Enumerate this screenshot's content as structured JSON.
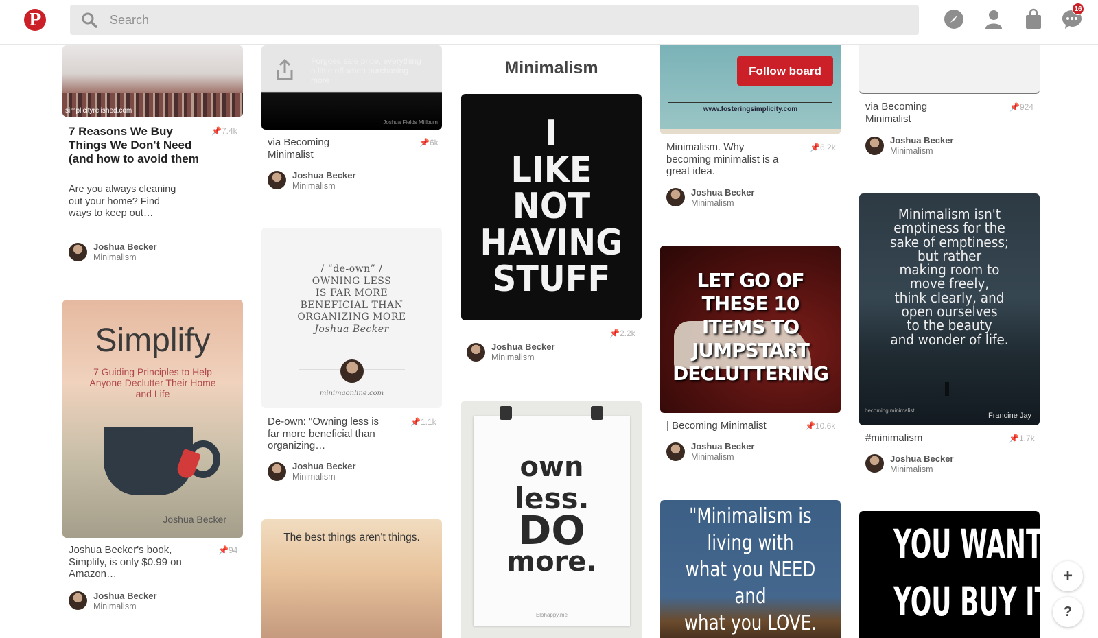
{
  "header": {
    "search_placeholder": "Search",
    "notification_count": "16",
    "brand_color": "#cb2027"
  },
  "board": {
    "title": "Minimalism",
    "follow_label": "Follow board"
  },
  "pins": [
    {
      "id": "p1",
      "title": "7 Reasons We Buy Things We Don't Need (and how to avoid them",
      "desc": "Are you always cleaning out your home? Find ways to keep out…",
      "repins": "7.4k",
      "user": "Joshua Becker",
      "board": "Minimalism",
      "img_caption": "simplicityrelished.com"
    },
    {
      "id": "p2",
      "desc": "via Becoming Minimalist",
      "repins": "6k",
      "user": "Joshua Becker",
      "board": "Minimalism",
      "img_caption": "Joshua Fields Millburn",
      "img_text": "Forgoes sale price, everything a little off when purchasing more"
    },
    {
      "id": "p3",
      "img_lines": [
        "I",
        "LIKE",
        "NOT",
        "HAVING",
        "STUFF"
      ],
      "repins": "2.2k",
      "user": "Joshua Becker",
      "board": "Minimalism"
    },
    {
      "id": "p4",
      "desc": "Minimalism. Why becoming minimalist is a great idea.",
      "repins": "6.2k",
      "user": "Joshua Becker",
      "board": "Minimalism",
      "img_caption": "www.fosteringsimplicity.com"
    },
    {
      "id": "p5",
      "desc": "via Becoming Minimalist",
      "repins": "924",
      "user": "Joshua Becker",
      "board": "Minimalism"
    },
    {
      "id": "p6",
      "img_lines": [
        "/ “de-own” /",
        "OWNING LESS",
        "IS FAR MORE",
        "BENEFICIAL THAN",
        "ORGANIZING MORE",
        "Joshua Becker"
      ],
      "img_caption": "minimaonline.com",
      "desc": "De-own: \"Owning less is far more beneficial than organizing…",
      "repins": "1.1k",
      "user": "Joshua Becker",
      "board": "Minimalism"
    },
    {
      "id": "p7",
      "img_title": "Simplify",
      "img_sub": "7 Guiding Principles to Help Anyone Declutter Their Home and Life",
      "img_author": "Joshua Becker",
      "desc": "Joshua Becker's book, Simplify, is only $0.99 on Amazon…",
      "repins": "94",
      "user": "Joshua Becker",
      "board": "Minimalism"
    },
    {
      "id": "p8",
      "img_lines": [
        "LET GO OF",
        "THESE 10",
        "ITEMS TO",
        "JUMPSTART",
        "DECLUTTERING"
      ],
      "desc": "| Becoming Minimalist",
      "repins": "10.6k",
      "user": "Joshua Becker",
      "board": "Minimalism"
    },
    {
      "id": "p9",
      "img_lines": [
        "Minimalism isn't",
        "emptiness for the",
        "sake of emptiness;",
        "but rather",
        "making room to",
        "move freely,",
        "think clearly, and",
        "open ourselves",
        "to the beauty",
        "and wonder of life."
      ],
      "img_author": "Francine Jay",
      "img_logo": "becoming minimalist",
      "desc": "#minimalism",
      "repins": "1.7k",
      "user": "Joshua Becker",
      "board": "Minimalism"
    },
    {
      "id": "p10",
      "img_lines": [
        "own",
        "less.",
        "DO",
        "more."
      ],
      "img_caption": "Elohappy.me"
    },
    {
      "id": "p11",
      "img_text": "The best things aren't things."
    },
    {
      "id": "p12",
      "img_lines": [
        "\"Minimalism is",
        "living with",
        "what you NEED",
        "and",
        "what you LOVE."
      ]
    },
    {
      "id": "p13",
      "img_lines": [
        "YOU WANT IT",
        "YOU BUY IT"
      ]
    }
  ],
  "floating": {
    "add": "+",
    "help": "?"
  }
}
